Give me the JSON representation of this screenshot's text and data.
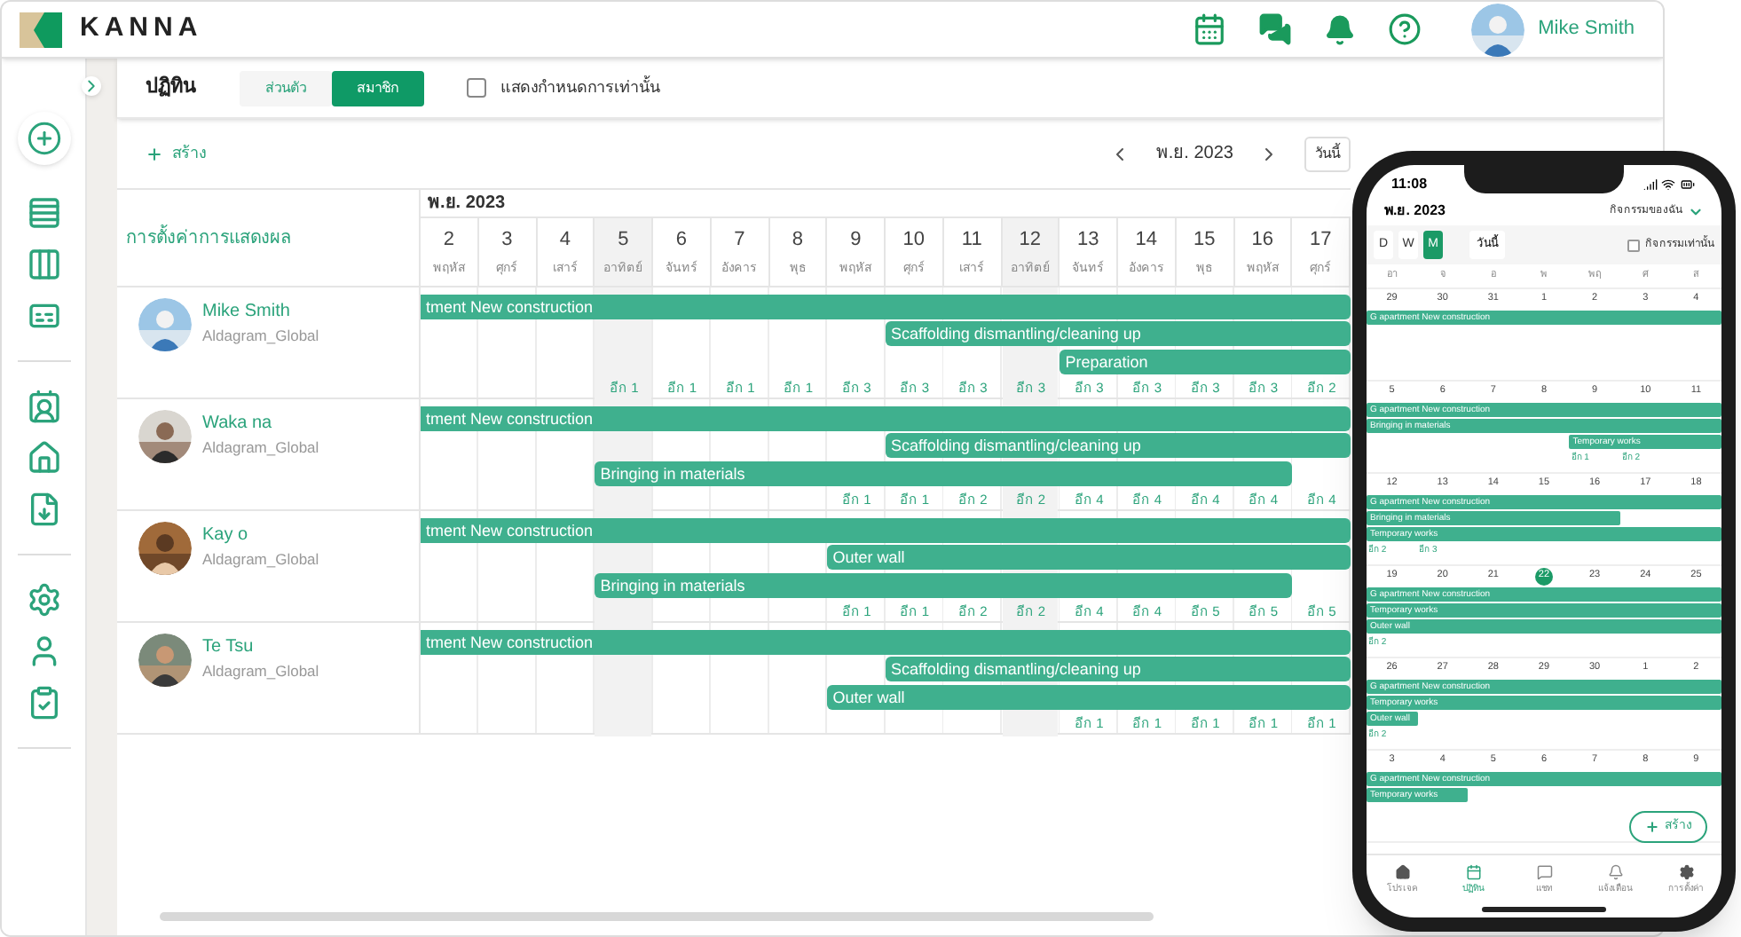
{
  "app": {
    "logo": "KANNA",
    "user": "Mike Smith"
  },
  "page": {
    "title": "ปฏิทิน",
    "view_tabs": [
      {
        "label": "ส่วนตัว",
        "selected": false
      },
      {
        "label": "สมาชิก",
        "selected": true
      }
    ],
    "schedule_only": {
      "label": "แสดงกำหนดการเท่านั้น",
      "checked": false
    }
  },
  "toolbar": {
    "create": "สร้าง",
    "month": "พ.ย. 2023",
    "today": "วันนี้"
  },
  "gantt": {
    "settings": "การตั้งค่าการแสดงผล",
    "month": "พ.ย. 2023",
    "days": [
      {
        "day": "2",
        "weekday": "พฤหัส",
        "weekend": false
      },
      {
        "day": "3",
        "weekday": "ศุกร์",
        "weekend": false
      },
      {
        "day": "4",
        "weekday": "เสาร์",
        "weekend": false
      },
      {
        "day": "5",
        "weekday": "อาทิตย์",
        "weekend": true
      },
      {
        "day": "6",
        "weekday": "จันทร์",
        "weekend": false
      },
      {
        "day": "7",
        "weekday": "อังคาร",
        "weekend": false
      },
      {
        "day": "8",
        "weekday": "พุธ",
        "weekend": false
      },
      {
        "day": "9",
        "weekday": "พฤหัส",
        "weekend": false
      },
      {
        "day": "10",
        "weekday": "ศุกร์",
        "weekend": false
      },
      {
        "day": "11",
        "weekday": "เสาร์",
        "weekend": false
      },
      {
        "day": "12",
        "weekday": "อาทิตย์",
        "weekend": true
      },
      {
        "day": "13",
        "weekday": "จันทร์",
        "weekend": false
      },
      {
        "day": "14",
        "weekday": "อังคาร",
        "weekend": false
      },
      {
        "day": "15",
        "weekday": "พุธ",
        "weekend": false
      },
      {
        "day": "16",
        "weekday": "พฤหัส",
        "weekend": false
      },
      {
        "day": "17",
        "weekday": "ศุกร์",
        "weekend": false
      }
    ],
    "members": [
      {
        "name": "Mike Smith",
        "org": "Aldagram_Global",
        "lanes": [
          [
            {
              "kind": "bar",
              "label": "tment New construction"
            },
            {
              "kind": "more"
            },
            {
              "kind": "more"
            },
            {
              "kind": "more"
            },
            {
              "kind": "more"
            },
            {
              "kind": "more"
            },
            {
              "kind": "more"
            },
            {
              "kind": "more"
            },
            {
              "kind": "more"
            },
            {
              "kind": "more"
            },
            {
              "kind": "more"
            },
            {
              "kind": "more"
            },
            {
              "kind": "more"
            },
            {
              "kind": "more"
            },
            {
              "kind": "more"
            },
            {
              "kind": "more"
            }
          ],
          [
            {
              "kind": "gap"
            },
            {
              "kind": "gap"
            },
            {
              "kind": "gap"
            },
            {
              "kind": "gap"
            },
            {
              "kind": "gap"
            },
            {
              "kind": "gap"
            },
            {
              "kind": "gap"
            },
            {
              "kind": "gap"
            },
            {
              "kind": "bar",
              "label": "Scaffolding dismantling/cleaning up"
            },
            {
              "kind": "more"
            },
            {
              "kind": "more"
            },
            {
              "kind": "more"
            },
            {
              "kind": "more"
            },
            {
              "kind": "more"
            },
            {
              "kind": "more"
            },
            {
              "kind": "more"
            }
          ],
          [
            {
              "kind": "gap"
            },
            {
              "kind": "gap"
            },
            {
              "kind": "gap"
            },
            {
              "kind": "gap"
            },
            {
              "kind": "gap"
            },
            {
              "kind": "gap"
            },
            {
              "kind": "gap"
            },
            {
              "kind": "gap"
            },
            {
              "kind": "gap"
            },
            {
              "kind": "gap"
            },
            {
              "kind": "gap"
            },
            {
              "kind": "bar",
              "label": "Preparation"
            },
            {
              "kind": "more"
            },
            {
              "kind": "more"
            },
            {
              "kind": "more"
            },
            {
              "kind": "more"
            }
          ]
        ],
        "counts": [
          {
            "kind": "none"
          },
          {
            "kind": "none"
          },
          {
            "kind": "none"
          },
          {
            "kind": "count",
            "label": "อีก 1"
          },
          {
            "kind": "count",
            "label": "อีก 1"
          },
          {
            "kind": "count",
            "label": "อีก 1"
          },
          {
            "kind": "count",
            "label": "อีก 1"
          },
          {
            "kind": "count",
            "label": "อีก 3"
          },
          {
            "kind": "count",
            "label": "อีก 3"
          },
          {
            "kind": "count",
            "label": "อีก 3"
          },
          {
            "kind": "count",
            "label": "อีก 3"
          },
          {
            "kind": "count",
            "label": "อีก 3"
          },
          {
            "kind": "count",
            "label": "อีก 3"
          },
          {
            "kind": "count",
            "label": "อีก 3"
          },
          {
            "kind": "count",
            "label": "อีก 3"
          },
          {
            "kind": "count",
            "label": "อีก 2"
          }
        ]
      },
      {
        "name": "Waka na",
        "org": "Aldagram_Global",
        "lanes": [
          [
            {
              "kind": "bar",
              "label": "tment New construction"
            },
            {
              "kind": "more"
            },
            {
              "kind": "more"
            },
            {
              "kind": "more"
            },
            {
              "kind": "more"
            },
            {
              "kind": "more"
            },
            {
              "kind": "more"
            },
            {
              "kind": "more"
            },
            {
              "kind": "more"
            },
            {
              "kind": "more"
            },
            {
              "kind": "more"
            },
            {
              "kind": "more"
            },
            {
              "kind": "more"
            },
            {
              "kind": "more"
            },
            {
              "kind": "more"
            },
            {
              "kind": "more"
            }
          ],
          [
            {
              "kind": "gap"
            },
            {
              "kind": "gap"
            },
            {
              "kind": "gap"
            },
            {
              "kind": "gap"
            },
            {
              "kind": "gap"
            },
            {
              "kind": "gap"
            },
            {
              "kind": "gap"
            },
            {
              "kind": "gap"
            },
            {
              "kind": "bar",
              "label": "Scaffolding dismantling/cleaning up"
            },
            {
              "kind": "more"
            },
            {
              "kind": "more"
            },
            {
              "kind": "more"
            },
            {
              "kind": "more"
            },
            {
              "kind": "more"
            },
            {
              "kind": "more"
            },
            {
              "kind": "more"
            }
          ],
          [
            {
              "kind": "gap"
            },
            {
              "kind": "gap"
            },
            {
              "kind": "gap"
            },
            {
              "kind": "bar",
              "label": "Bringing in materials"
            },
            {
              "kind": "more"
            },
            {
              "kind": "more"
            },
            {
              "kind": "more"
            },
            {
              "kind": "more"
            },
            {
              "kind": "more"
            },
            {
              "kind": "more"
            },
            {
              "kind": "more"
            },
            {
              "kind": "more"
            },
            {
              "kind": "more"
            },
            {
              "kind": "more"
            },
            {
              "kind": "more"
            },
            {
              "kind": "gap"
            }
          ]
        ],
        "counts": [
          {
            "kind": "none"
          },
          {
            "kind": "none"
          },
          {
            "kind": "none"
          },
          {
            "kind": "none"
          },
          {
            "kind": "none"
          },
          {
            "kind": "none"
          },
          {
            "kind": "none"
          },
          {
            "kind": "count",
            "label": "อีก 1"
          },
          {
            "kind": "count",
            "label": "อีก 1"
          },
          {
            "kind": "count",
            "label": "อีก 2"
          },
          {
            "kind": "count",
            "label": "อีก 2"
          },
          {
            "kind": "count",
            "label": "อีก 4"
          },
          {
            "kind": "count",
            "label": "อีก 4"
          },
          {
            "kind": "count",
            "label": "อีก 4"
          },
          {
            "kind": "count",
            "label": "อีก 4"
          },
          {
            "kind": "count",
            "label": "อีก 4"
          }
        ]
      },
      {
        "name": "Kay o",
        "org": "Aldagram_Global",
        "lanes": [
          [
            {
              "kind": "bar",
              "label": "tment New construction"
            },
            {
              "kind": "more"
            },
            {
              "kind": "more"
            },
            {
              "kind": "more"
            },
            {
              "kind": "more"
            },
            {
              "kind": "more"
            },
            {
              "kind": "more"
            },
            {
              "kind": "more"
            },
            {
              "kind": "more"
            },
            {
              "kind": "more"
            },
            {
              "kind": "more"
            },
            {
              "kind": "more"
            },
            {
              "kind": "more"
            },
            {
              "kind": "more"
            },
            {
              "kind": "more"
            },
            {
              "kind": "more"
            }
          ],
          [
            {
              "kind": "gap"
            },
            {
              "kind": "gap"
            },
            {
              "kind": "gap"
            },
            {
              "kind": "gap"
            },
            {
              "kind": "gap"
            },
            {
              "kind": "gap"
            },
            {
              "kind": "gap"
            },
            {
              "kind": "bar",
              "label": "Outer wall"
            },
            {
              "kind": "more"
            },
            {
              "kind": "more"
            },
            {
              "kind": "more"
            },
            {
              "kind": "more"
            },
            {
              "kind": "more"
            },
            {
              "kind": "more"
            },
            {
              "kind": "more"
            },
            {
              "kind": "more"
            }
          ],
          [
            {
              "kind": "gap"
            },
            {
              "kind": "gap"
            },
            {
              "kind": "gap"
            },
            {
              "kind": "bar",
              "label": "Bringing in materials"
            },
            {
              "kind": "more"
            },
            {
              "kind": "more"
            },
            {
              "kind": "more"
            },
            {
              "kind": "more"
            },
            {
              "kind": "more"
            },
            {
              "kind": "more"
            },
            {
              "kind": "more"
            },
            {
              "kind": "more"
            },
            {
              "kind": "more"
            },
            {
              "kind": "more"
            },
            {
              "kind": "more"
            },
            {
              "kind": "gap"
            }
          ]
        ],
        "counts": [
          {
            "kind": "none"
          },
          {
            "kind": "none"
          },
          {
            "kind": "none"
          },
          {
            "kind": "none"
          },
          {
            "kind": "none"
          },
          {
            "kind": "none"
          },
          {
            "kind": "none"
          },
          {
            "kind": "count",
            "label": "อีก 1"
          },
          {
            "kind": "count",
            "label": "อีก 1"
          },
          {
            "kind": "count",
            "label": "อีก 2"
          },
          {
            "kind": "count",
            "label": "อีก 2"
          },
          {
            "kind": "count",
            "label": "อีก 4"
          },
          {
            "kind": "count",
            "label": "อีก 4"
          },
          {
            "kind": "count",
            "label": "อีก 5"
          },
          {
            "kind": "count",
            "label": "อีก 5"
          },
          {
            "kind": "count",
            "label": "อีก 5"
          }
        ]
      },
      {
        "name": "Te Tsu",
        "org": "Aldagram_Global",
        "lanes": [
          [
            {
              "kind": "bar",
              "label": "tment New construction"
            },
            {
              "kind": "more"
            },
            {
              "kind": "more"
            },
            {
              "kind": "more"
            },
            {
              "kind": "more"
            },
            {
              "kind": "more"
            },
            {
              "kind": "more"
            },
            {
              "kind": "more"
            },
            {
              "kind": "more"
            },
            {
              "kind": "more"
            },
            {
              "kind": "more"
            },
            {
              "kind": "more"
            },
            {
              "kind": "more"
            },
            {
              "kind": "more"
            },
            {
              "kind": "more"
            },
            {
              "kind": "more"
            }
          ],
          [
            {
              "kind": "gap"
            },
            {
              "kind": "gap"
            },
            {
              "kind": "gap"
            },
            {
              "kind": "gap"
            },
            {
              "kind": "gap"
            },
            {
              "kind": "gap"
            },
            {
              "kind": "gap"
            },
            {
              "kind": "gap"
            },
            {
              "kind": "bar",
              "label": "Scaffolding dismantling/cleaning up"
            },
            {
              "kind": "more"
            },
            {
              "kind": "more"
            },
            {
              "kind": "more"
            },
            {
              "kind": "more"
            },
            {
              "kind": "more"
            },
            {
              "kind": "more"
            },
            {
              "kind": "more"
            }
          ],
          [
            {
              "kind": "gap"
            },
            {
              "kind": "gap"
            },
            {
              "kind": "gap"
            },
            {
              "kind": "gap"
            },
            {
              "kind": "gap"
            },
            {
              "kind": "gap"
            },
            {
              "kind": "gap"
            },
            {
              "kind": "bar",
              "label": "Outer wall"
            },
            {
              "kind": "more"
            },
            {
              "kind": "more"
            },
            {
              "kind": "more"
            },
            {
              "kind": "more"
            },
            {
              "kind": "more"
            },
            {
              "kind": "more"
            },
            {
              "kind": "more"
            },
            {
              "kind": "more"
            }
          ]
        ],
        "counts": [
          {
            "kind": "none"
          },
          {
            "kind": "none"
          },
          {
            "kind": "none"
          },
          {
            "kind": "none"
          },
          {
            "kind": "none"
          },
          {
            "kind": "none"
          },
          {
            "kind": "none"
          },
          {
            "kind": "none"
          },
          {
            "kind": "none"
          },
          {
            "kind": "none"
          },
          {
            "kind": "none"
          },
          {
            "kind": "count",
            "label": "อีก 1"
          },
          {
            "kind": "count",
            "label": "อีก 1"
          },
          {
            "kind": "count",
            "label": "อีก 1"
          },
          {
            "kind": "count",
            "label": "อีก 1"
          },
          {
            "kind": "count",
            "label": "อีก 1"
          }
        ]
      }
    ]
  },
  "phone": {
    "time": "11:08",
    "month": "พ.ย. 2023",
    "filter": "กิจกรรมของฉัน",
    "modes": [
      {
        "label": "D",
        "selected": false
      },
      {
        "label": "W",
        "selected": false
      },
      {
        "label": "M",
        "selected": true
      }
    ],
    "today": "วันนี้",
    "events_only": {
      "label": "กิจกรรมเท่านั้น",
      "checked": false
    },
    "weekdays": [
      "อา",
      "จ",
      "อ",
      "พ",
      "พฤ",
      "ศ",
      "ส"
    ],
    "weeks": [
      {
        "days": [
          {
            "d": "29",
            "today": false
          },
          {
            "d": "30",
            "today": false
          },
          {
            "d": "31",
            "today": false
          },
          {
            "d": "1",
            "today": false
          },
          {
            "d": "2",
            "today": false
          },
          {
            "d": "3",
            "today": false
          },
          {
            "d": "4",
            "today": false
          }
        ],
        "lanes": [
          [
            {
              "kind": "bar",
              "label": "G apartment New construction"
            },
            {
              "kind": "more"
            },
            {
              "kind": "more"
            },
            {
              "kind": "more"
            },
            {
              "kind": "more"
            },
            {
              "kind": "more"
            },
            {
              "kind": "more"
            }
          ]
        ]
      },
      {
        "days": [
          {
            "d": "5",
            "today": false
          },
          {
            "d": "6",
            "today": false
          },
          {
            "d": "7",
            "today": false
          },
          {
            "d": "8",
            "today": false
          },
          {
            "d": "9",
            "today": false
          },
          {
            "d": "10",
            "today": false
          },
          {
            "d": "11",
            "today": false
          }
        ],
        "lanes": [
          [
            {
              "kind": "bar",
              "label": "G apartment New construction"
            },
            {
              "kind": "more"
            },
            {
              "kind": "more"
            },
            {
              "kind": "more"
            },
            {
              "kind": "more"
            },
            {
              "kind": "more"
            },
            {
              "kind": "more"
            }
          ],
          [
            {
              "kind": "bar",
              "label": "Bringing in materials"
            },
            {
              "kind": "more"
            },
            {
              "kind": "more"
            },
            {
              "kind": "more"
            },
            {
              "kind": "more"
            },
            {
              "kind": "more"
            },
            {
              "kind": "more"
            }
          ],
          [
            {
              "kind": "gap"
            },
            {
              "kind": "gap"
            },
            {
              "kind": "gap"
            },
            {
              "kind": "gap"
            },
            {
              "kind": "bar",
              "label": "Temporary works"
            },
            {
              "kind": "more"
            },
            {
              "kind": "more"
            }
          ]
        ],
        "counts": [
          {
            "kind": "none"
          },
          {
            "kind": "none"
          },
          {
            "kind": "none"
          },
          {
            "kind": "none"
          },
          {
            "kind": "count",
            "label": "อีก 1"
          },
          {
            "kind": "count",
            "label": "อีก 2"
          },
          {
            "kind": "none"
          }
        ]
      },
      {
        "days": [
          {
            "d": "12",
            "today": false
          },
          {
            "d": "13",
            "today": false
          },
          {
            "d": "14",
            "today": false
          },
          {
            "d": "15",
            "today": false
          },
          {
            "d": "16",
            "today": false
          },
          {
            "d": "17",
            "today": false
          },
          {
            "d": "18",
            "today": false
          }
        ],
        "lanes": [
          [
            {
              "kind": "bar",
              "label": "G apartment New construction"
            },
            {
              "kind": "more"
            },
            {
              "kind": "more"
            },
            {
              "kind": "more"
            },
            {
              "kind": "more"
            },
            {
              "kind": "more"
            },
            {
              "kind": "more"
            }
          ],
          [
            {
              "kind": "bar",
              "label": "Bringing in materials"
            },
            {
              "kind": "more"
            },
            {
              "kind": "more"
            },
            {
              "kind": "more"
            },
            {
              "kind": "more"
            },
            {
              "kind": "gap"
            },
            {
              "kind": "gap"
            }
          ],
          [
            {
              "kind": "bar",
              "label": "Temporary works"
            },
            {
              "kind": "more"
            },
            {
              "kind": "more"
            },
            {
              "kind": "more"
            },
            {
              "kind": "more"
            },
            {
              "kind": "more"
            },
            {
              "kind": "more"
            }
          ]
        ],
        "counts": [
          {
            "kind": "count",
            "label": "อีก 2"
          },
          {
            "kind": "count",
            "label": "อีก 3"
          },
          {
            "kind": "none"
          },
          {
            "kind": "none"
          },
          {
            "kind": "none"
          },
          {
            "kind": "none"
          },
          {
            "kind": "none"
          }
        ]
      },
      {
        "days": [
          {
            "d": "19",
            "today": false
          },
          {
            "d": "20",
            "today": false
          },
          {
            "d": "21",
            "today": false
          },
          {
            "d": "22",
            "today": true
          },
          {
            "d": "23",
            "today": false
          },
          {
            "d": "24",
            "today": false
          },
          {
            "d": "25",
            "today": false
          }
        ],
        "lanes": [
          [
            {
              "kind": "bar",
              "label": "G apartment New construction"
            },
            {
              "kind": "more"
            },
            {
              "kind": "more"
            },
            {
              "kind": "more"
            },
            {
              "kind": "more"
            },
            {
              "kind": "more"
            },
            {
              "kind": "more"
            }
          ],
          [
            {
              "kind": "bar",
              "label": "Temporary works"
            },
            {
              "kind": "more"
            },
            {
              "kind": "more"
            },
            {
              "kind": "more"
            },
            {
              "kind": "more"
            },
            {
              "kind": "more"
            },
            {
              "kind": "more"
            }
          ],
          [
            {
              "kind": "bar",
              "label": "Outer wall"
            },
            {
              "kind": "more"
            },
            {
              "kind": "more"
            },
            {
              "kind": "more"
            },
            {
              "kind": "more"
            },
            {
              "kind": "more"
            },
            {
              "kind": "more"
            }
          ]
        ],
        "counts": [
          {
            "kind": "count",
            "label": "อีก 2"
          },
          {
            "kind": "none"
          },
          {
            "kind": "none"
          },
          {
            "kind": "none"
          },
          {
            "kind": "none"
          },
          {
            "kind": "none"
          },
          {
            "kind": "none"
          }
        ]
      },
      {
        "days": [
          {
            "d": "26",
            "today": false
          },
          {
            "d": "27",
            "today": false
          },
          {
            "d": "28",
            "today": false
          },
          {
            "d": "29",
            "today": false
          },
          {
            "d": "30",
            "today": false
          },
          {
            "d": "1",
            "today": false
          },
          {
            "d": "2",
            "today": false
          }
        ],
        "lanes": [
          [
            {
              "kind": "bar",
              "label": "G apartment New construction"
            },
            {
              "kind": "more"
            },
            {
              "kind": "more"
            },
            {
              "kind": "more"
            },
            {
              "kind": "more"
            },
            {
              "kind": "more"
            },
            {
              "kind": "more"
            }
          ],
          [
            {
              "kind": "bar",
              "label": "Temporary works"
            },
            {
              "kind": "more"
            },
            {
              "kind": "more"
            },
            {
              "kind": "more"
            },
            {
              "kind": "more"
            },
            {
              "kind": "more"
            },
            {
              "kind": "more"
            }
          ],
          [
            {
              "kind": "bar",
              "label": "Outer wall"
            },
            {
              "kind": "gap"
            },
            {
              "kind": "gap"
            },
            {
              "kind": "gap"
            },
            {
              "kind": "gap"
            },
            {
              "kind": "gap"
            },
            {
              "kind": "gap"
            }
          ]
        ],
        "counts": [
          {
            "kind": "count",
            "label": "อีก 2"
          },
          {
            "kind": "none"
          },
          {
            "kind": "none"
          },
          {
            "kind": "none"
          },
          {
            "kind": "none"
          },
          {
            "kind": "none"
          },
          {
            "kind": "none"
          }
        ]
      },
      {
        "days": [
          {
            "d": "3",
            "today": false
          },
          {
            "d": "4",
            "today": false
          },
          {
            "d": "5",
            "today": false
          },
          {
            "d": "6",
            "today": false
          },
          {
            "d": "7",
            "today": false
          },
          {
            "d": "8",
            "today": false
          },
          {
            "d": "9",
            "today": false
          }
        ],
        "lanes": [
          [
            {
              "kind": "bar",
              "label": "G apartment New construction"
            },
            {
              "kind": "more"
            },
            {
              "kind": "more"
            },
            {
              "kind": "more"
            },
            {
              "kind": "more"
            },
            {
              "kind": "more"
            },
            {
              "kind": "more"
            }
          ],
          [
            {
              "kind": "bar",
              "label": "Temporary works"
            },
            {
              "kind": "more"
            },
            {
              "kind": "gap"
            },
            {
              "kind": "gap"
            },
            {
              "kind": "gap"
            },
            {
              "kind": "gap"
            },
            {
              "kind": "gap"
            }
          ]
        ]
      }
    ],
    "create": "สร้าง",
    "nav": [
      {
        "label": "โปรเจค",
        "kind": "home",
        "selected": false
      },
      {
        "label": "ปฏิทิน",
        "kind": "calendar",
        "selected": true
      },
      {
        "label": "แชท",
        "kind": "chat",
        "selected": false
      },
      {
        "label": "แจ้งเตือน",
        "kind": "bell",
        "selected": false
      },
      {
        "label": "การตั้งค่า",
        "kind": "settings",
        "selected": false
      }
    ]
  }
}
